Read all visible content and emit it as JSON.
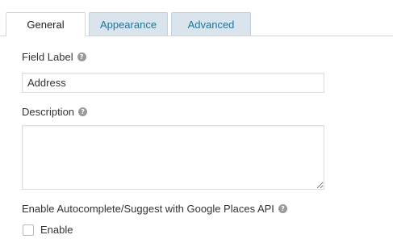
{
  "tabs": [
    {
      "label": "General",
      "active": true
    },
    {
      "label": "Appearance",
      "active": false
    },
    {
      "label": "Advanced",
      "active": false
    }
  ],
  "help_glyph": "?",
  "field_label": {
    "label": "Field Label",
    "value": "Address"
  },
  "description": {
    "label": "Description",
    "value": ""
  },
  "autocomplete": {
    "label": "Enable Autocomplete/Suggest with Google Places API",
    "checkbox_label": "Enable",
    "checked": false
  },
  "colors": {
    "inactive_tab_bg": "#dae4ed",
    "inactive_tab_text": "#21759b",
    "help_icon": "#9a9a9a"
  },
  "icons": {
    "help": "question-circle-icon"
  }
}
